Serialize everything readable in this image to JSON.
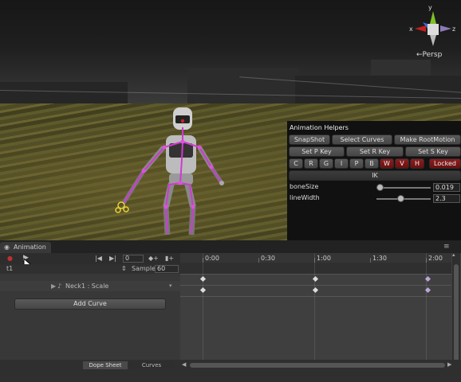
{
  "scene": {
    "persp_label": "←Persp",
    "gizmo_axes": {
      "x": "x",
      "y": "y",
      "z": "z"
    }
  },
  "helpers": {
    "title": "Animation Helpers",
    "row1": [
      "SnapShot",
      "Select Curves",
      "Make RootMotion"
    ],
    "row2": [
      "Set P Key",
      "Set R Key",
      "Set S Key"
    ],
    "letter_buttons": [
      "C",
      "R",
      "G",
      "I",
      "P",
      "B",
      "W",
      "V",
      "H"
    ],
    "locked_label": "Locked",
    "ik_label": "IK",
    "params": [
      {
        "label": "boneSize",
        "value": "0.019",
        "slider": 0.05
      },
      {
        "label": "lineWidth",
        "value": "2.3",
        "slider": 0.48
      }
    ]
  },
  "animation": {
    "tab_label": "Animation",
    "time_field": "0",
    "clip_name": "t1",
    "sample_label": "Sample",
    "sample_value": "60",
    "timeline_labels": [
      "0:00",
      "0:30",
      "1:00",
      "1:30",
      "2:00"
    ],
    "property_label": "Neck1 : Scale",
    "add_curve_label": "Add Curve",
    "bottom_tabs": [
      "Dope Sheet",
      "Curves"
    ]
  },
  "colors": {
    "accent_red": "#8a1f1f",
    "gizmo_x": "#c22020",
    "gizmo_y": "#7fc02a",
    "gizmo_z": "#3a6fd0",
    "robot_magenta": "#d03ad0"
  }
}
